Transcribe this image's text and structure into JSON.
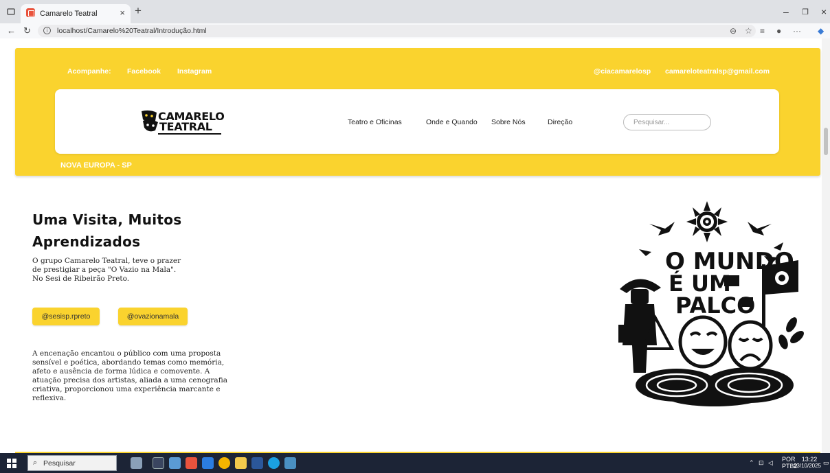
{
  "browser": {
    "tab_title": "Camarelo Teatral",
    "tab_close": "×",
    "new_tab": "+",
    "url": "localhost/Camarelo%20Teatral/Introdução.html",
    "win_min": "–",
    "win_restore": "❐",
    "win_close": "×"
  },
  "header": {
    "follow_label": "Acompanhe:",
    "facebook": "Facebook",
    "instagram": "Instagram",
    "handle": "@ciacamarelosp",
    "email": "camareloteatralsp@gmail.com",
    "logo_line1": "CAMARELO",
    "logo_line2": "TEATRAL",
    "nav": [
      "Teatro e Oficinas",
      "Onde e Quando",
      "Sobre Nós",
      "Direção"
    ],
    "search_placeholder": "Pesquisar...",
    "city": "NOVA EUROPA - SP"
  },
  "main": {
    "title_line1": "Uma Visita, Muitos",
    "title_line2": "Aprendizados",
    "intro": "O grupo Camarelo Teatral, teve o prazer de prestigiar a peça \"O Vazio na Mala\". No Sesi de Ribeirão Preto.",
    "tag1": "@sesisp.rpreto",
    "tag2": "@ovazionamala",
    "body": "A encenação encantou o público com uma proposta sensível e poética, abordando temas como memória, afeto e ausência de forma lúdica e comovente. A atuação precisa dos artistas, aliada a uma cenografia criativa, proporcionou uma experiência marcante e reflexiva."
  },
  "poster": {
    "line1": "O MUNDO",
    "line2": "É UM",
    "line3": "PALCO"
  },
  "taskbar": {
    "search_label": "Pesquisar",
    "lang": "POR",
    "layout": "PTB2",
    "time": "13:22",
    "date": "23/10/2025"
  },
  "colors": {
    "brand_yellow": "#fad32e",
    "taskbar": "#1c2436"
  }
}
